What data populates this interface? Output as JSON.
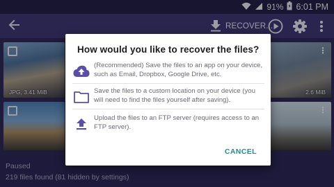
{
  "status_bar": {
    "battery": "91%",
    "time": "6:01 PM",
    "icons": [
      "wifi-icon",
      "signal-icon",
      "battery-icon"
    ]
  },
  "app_bar": {
    "back_icon": "back-arrow-icon",
    "recover_label": "RECOVER...",
    "icons": [
      "download-icon",
      "play-icon",
      "gear-icon",
      "more-vert-icon"
    ]
  },
  "grid": {
    "tiles": [
      {
        "size": "JPG, 3.41 MiB"
      },
      {
        "size": "2.6 MiB"
      },
      {
        "size": ""
      },
      {
        "size": ""
      }
    ]
  },
  "footer": {
    "status": "Paused",
    "count": "219 files found (81 hidden by settings)"
  },
  "dialog": {
    "title": "How would you like to recover the files?",
    "options": [
      {
        "icon": "cloud-upload-icon",
        "text": "(Recommended) Save the files to an app on your device, such as Email, Dropbox, Google Drive, etc."
      },
      {
        "icon": "folder-icon",
        "text": "Save the files to a custom location on your device (you will need to find the files yourself after saving)."
      },
      {
        "icon": "upload-icon",
        "text": "Upload the files to an FTP server (requires access to an FTP server)."
      }
    ],
    "cancel_label": "CANCEL"
  },
  "colors": {
    "accent": "#5a4fa8",
    "button_text": "#1f8f95",
    "app_bar": "#3e3775",
    "status_bar": "#241f48"
  }
}
